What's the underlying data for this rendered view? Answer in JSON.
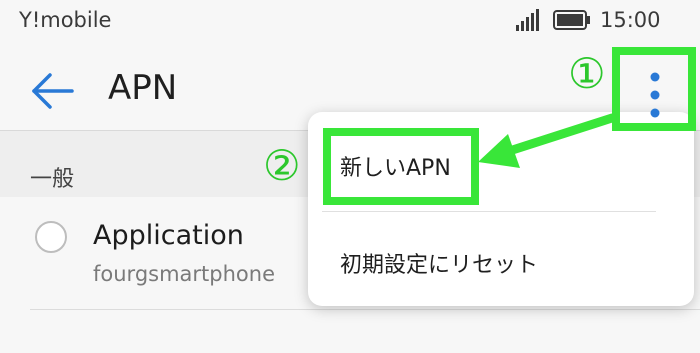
{
  "status_bar": {
    "carrier": "Y!mobile",
    "time": "15:00",
    "icons": [
      "signal-icon",
      "battery-icon"
    ]
  },
  "app_bar": {
    "back_icon": "back-arrow-icon",
    "title": "APN",
    "menu_icon": "more-vertical-icon"
  },
  "section": {
    "title": "一般"
  },
  "apn_list": [
    {
      "name": "Application",
      "apn": "fourgsmartphone",
      "selected": false
    }
  ],
  "popup_menu": {
    "items": [
      {
        "label": "新しいAPN"
      },
      {
        "label": "初期設定にリセット"
      }
    ]
  },
  "annotations": {
    "step1": "①",
    "step2": "②",
    "highlight_color": "#39e639"
  },
  "colors": {
    "accent": "#2979d6",
    "background": "#f7f7f7",
    "section_background": "#eeeeee"
  }
}
